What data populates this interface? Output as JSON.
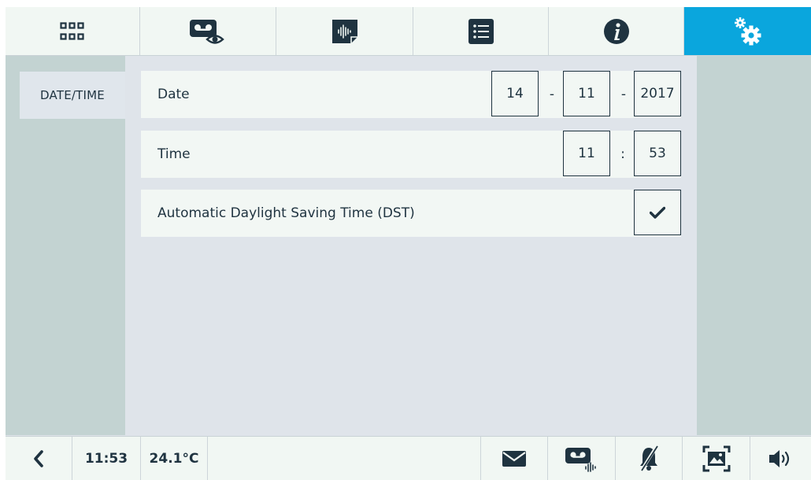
{
  "colors": {
    "accent": "#0aa6dd",
    "ink": "#1f3340",
    "panel": "#c3d3d2",
    "row_bg": "#f2f7f4"
  },
  "tabs": [
    {
      "icon": "apps-grid-icon",
      "active": false
    },
    {
      "icon": "video-memo-view-icon",
      "active": false
    },
    {
      "icon": "audio-memo-icon",
      "active": false
    },
    {
      "icon": "list-icon",
      "active": false
    },
    {
      "icon": "info-icon",
      "active": false
    },
    {
      "icon": "settings-gears-icon",
      "active": true
    }
  ],
  "sidebar": {
    "items": [
      {
        "label": "DATE/TIME"
      }
    ]
  },
  "rows": {
    "date": {
      "label": "Date",
      "day": "14",
      "month": "11",
      "year": "2017",
      "separator": "-"
    },
    "time": {
      "label": "Time",
      "hour": "11",
      "minute": "53",
      "separator": ":"
    },
    "dst": {
      "label": "Automatic Daylight Saving Time (DST)",
      "checked": true
    }
  },
  "statusbar": {
    "back_icon": "back-chevron-icon",
    "clock": "11:53",
    "temperature": "24.1°C",
    "icons": [
      "envelope-icon",
      "video-memo-audio-icon",
      "bell-muted-icon",
      "picture-frame-icon",
      "speaker-icon"
    ]
  }
}
